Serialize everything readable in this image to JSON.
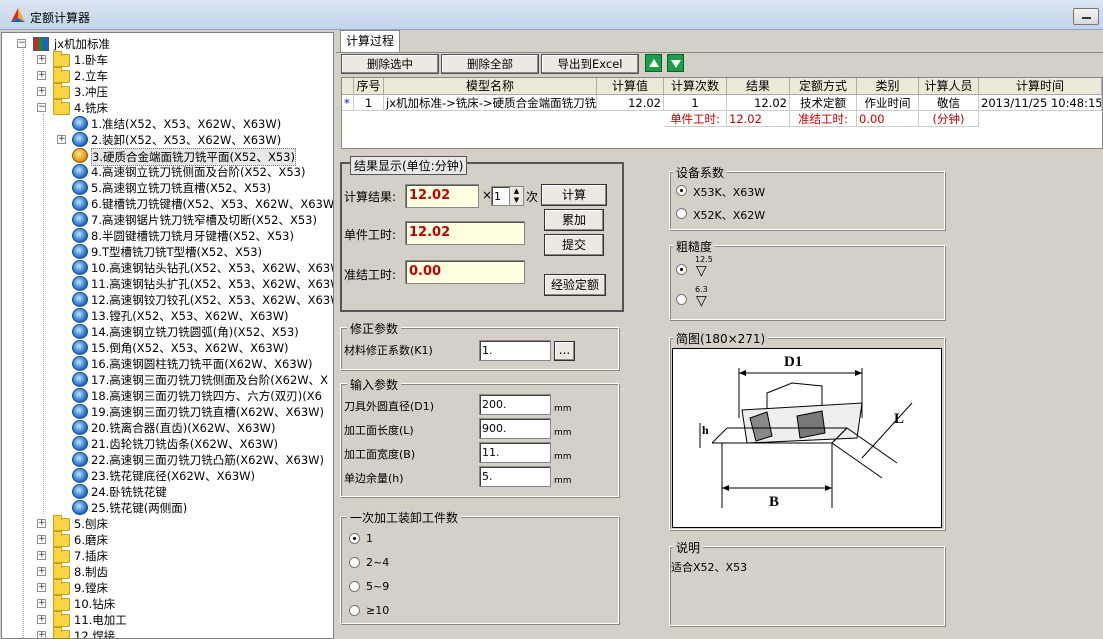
{
  "window": {
    "title": "定额计算器"
  },
  "tree": {
    "root": "jx机加标准",
    "categories": [
      "1.卧车",
      "2.立车",
      "3.冲压",
      "4.铣床"
    ],
    "mill_items": [
      "1.准结(X52、X53、X62W、X63W)",
      "2.装卸(X52、X53、X62W、X63W)",
      "3.硬质合金端面铣刀铣平面(X52、X53)",
      "4.高速钢立铣刀铣侧面及台阶(X52、X53)",
      "5.高速钢立铣刀铣直槽(X52、X53)",
      "6.键槽铣刀铣键槽(X52、X53、X62W、X63W)",
      "7.高速钢锯片铣刀铣窄槽及切断(X52、X53)",
      "8.半圆键槽铣刀铣月牙键槽(X52、X53)",
      "9.T型槽铣刀铣T型槽(X52、X53)",
      "10.高速钢钻头钻孔(X52、X53、X62W、X63W)",
      "11.高速钢钻头扩孔(X52、X53、X62W、X63W)",
      "12.高速钢铰刀铰孔(X52、X53、X62W、X63W)",
      "13.镗孔(X52、X53、X62W、X63W)",
      "14.高速钢立铣刀铣圆弧(角)(X52、X53)",
      "15.倒角(X52、X53、X62W、X63W)",
      "16.高速钢圆柱铣刀铣平面(X62W、X63W)",
      "17.高速钢三面刃铣刀铣侧面及台阶(X62W、X",
      "18.高速钢三面刃铣刀铣四方、六方(双刃)(X6",
      "19.高速钢三面刃铣刀铣直槽(X62W、X63W)",
      "20.铣离合器(直齿)(X62W、X63W)",
      "21.齿轮铣刀铣齿条(X62W、X63W)",
      "22.高速钢三面刃铣刀铣凸筋(X62W、X63W)",
      "23.铣花键底径(X62W、X63W)",
      "24.卧铣铣花键",
      "25.铣花键(两侧面)"
    ],
    "more_categories": [
      "5.刨床",
      "6.磨床",
      "7.插床",
      "8.制齿",
      "9.镗床",
      "10.钻床",
      "11.电加工",
      "12.焊接"
    ]
  },
  "tabs": [
    "计算过程"
  ],
  "toolbar": {
    "delete_selected": "删除选中",
    "delete_all": "删除全部",
    "export": "导出到Excel"
  },
  "grid": {
    "headers": [
      "序号",
      "模型名称",
      "计算值",
      "计算次数",
      "结果",
      "定额方式",
      "类别",
      "计算人员",
      "计算时间"
    ],
    "row_marker": "*",
    "rows": [
      [
        "1",
        "jx机加标准->铣床->硬质合金端面铣刀铣",
        "12.02",
        "1",
        "12.02",
        "技术定额",
        "作业时间",
        "敬信",
        "2013/11/25 10:48:15"
      ]
    ],
    "summary": {
      "unit_label": "单件工时:",
      "unit_value": "12.02",
      "prep_label": "准结工时:",
      "prep_value": "0.00",
      "unit_text": "(分钟)"
    }
  },
  "result": {
    "legend": "结果显示(单位:分钟)",
    "calc_label": "计算结果:",
    "calc_value": "12.02",
    "times_sign": "×",
    "multiplier": "1",
    "times_unit": "次",
    "unit_label": "单件工时:",
    "unit_value": "12.02",
    "prep_label": "准结工时:",
    "prep_value": "0.00",
    "btn_calc": "计算",
    "btn_accum": "累加",
    "btn_submit": "提交",
    "btn_exp": "经验定额"
  },
  "correction": {
    "legend": "修正参数",
    "k1_label": "材料修正系数(K1)",
    "k1_value": "1.",
    "browse": "..."
  },
  "inputs": {
    "legend": "输入参数",
    "unit": "mm",
    "fields": [
      {
        "label": "刀具外圆直径(D1)",
        "value": "200."
      },
      {
        "label": "加工面长度(L)",
        "value": "900."
      },
      {
        "label": "加工面宽度(B)",
        "value": "11."
      },
      {
        "label": "单边余量(h)",
        "value": "5."
      }
    ]
  },
  "batch": {
    "legend": "一次加工装卸工件数",
    "options": [
      "1",
      "2~4",
      "5~9",
      "≥10"
    ],
    "selected": 0
  },
  "equipment": {
    "legend": "设备系数",
    "options": [
      "X53K、X63W",
      "X52K、X62W"
    ],
    "selected": 0
  },
  "roughness": {
    "legend": "粗糙度",
    "options": [
      "12.5",
      "6.3"
    ],
    "selected": 0
  },
  "sketch": {
    "legend": "简图(180×271)",
    "label_d1": "D1",
    "label_l": "L",
    "label_b": "B",
    "label_h": "h"
  },
  "note": {
    "legend": "说明",
    "text": "适合X52、X53"
  }
}
